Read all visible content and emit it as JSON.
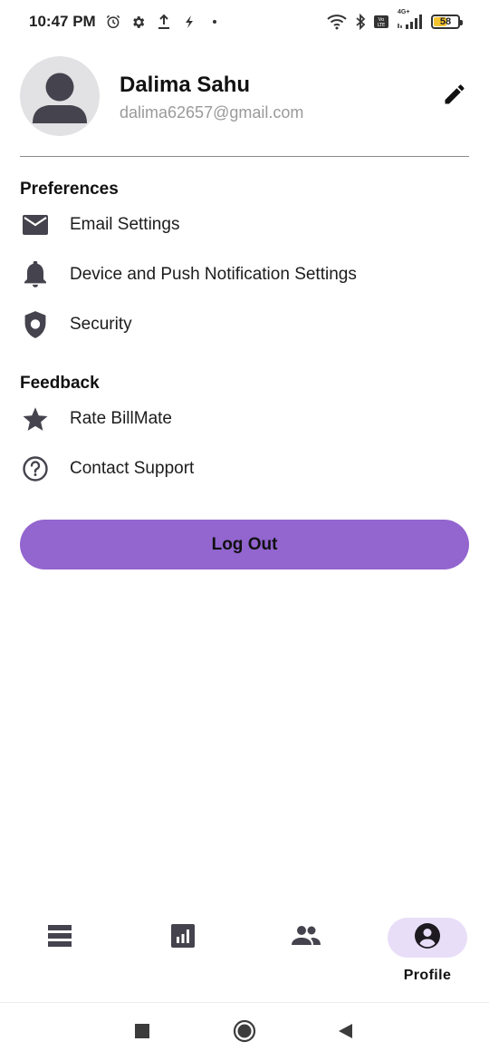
{
  "status_bar": {
    "time": "10:47 PM",
    "battery": "58",
    "battery_level": 0.58,
    "network": "4G+",
    "icons": [
      "alarm-icon",
      "gear-icon",
      "download-icon",
      "flash-icon",
      "dot-icon",
      "wifi-icon",
      "bluetooth-icon",
      "volte-icon",
      "signal-icon",
      "battery-icon"
    ]
  },
  "profile": {
    "name": "Dalima Sahu",
    "email": "dalima62657@gmail.com",
    "avatar_icon": "person-avatar-icon",
    "edit_icon": "pencil-icon"
  },
  "preferences": {
    "title": "Preferences",
    "items": [
      {
        "label": "Email Settings",
        "icon": "mail-icon"
      },
      {
        "label": "Device and Push Notification Settings",
        "icon": "bell-icon"
      },
      {
        "label": "Security",
        "icon": "shield-icon"
      }
    ]
  },
  "feedback": {
    "title": "Feedback",
    "items": [
      {
        "label": "Rate BillMate",
        "icon": "star-icon"
      },
      {
        "label": "Contact Support",
        "icon": "help-circle-icon"
      }
    ]
  },
  "logout_label": "Log Out",
  "bottom_nav": {
    "items": [
      {
        "icon": "list-icon",
        "label": ""
      },
      {
        "icon": "chart-icon",
        "label": ""
      },
      {
        "icon": "group-icon",
        "label": ""
      },
      {
        "icon": "account-circle-icon",
        "label": "Profile",
        "active": true
      }
    ]
  },
  "colors": {
    "accent": "#9265cf",
    "active_nav_bg": "#e8def8",
    "icon": "#45434d",
    "email_text": "#9a9a9a"
  }
}
